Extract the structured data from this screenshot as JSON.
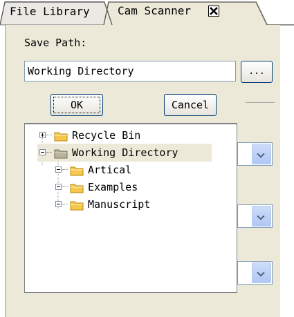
{
  "tabs": [
    {
      "label": "File Library"
    },
    {
      "label": "Cam Scanner",
      "active": true
    }
  ],
  "panel": {
    "save_path_label": "Save Path:",
    "path_value": "Working Directory",
    "browse_label": "..."
  },
  "popup": {
    "ok_label": "OK",
    "cancel_label": "Cancel",
    "tree": [
      {
        "label": "Recycle Bin",
        "level": 0,
        "expander": "plus",
        "selected": false
      },
      {
        "label": "Working Directory",
        "level": 0,
        "expander": "minus",
        "selected": true
      },
      {
        "label": "Artical",
        "level": 1,
        "expander": "minus",
        "selected": false
      },
      {
        "label": "Examples",
        "level": 1,
        "expander": "minus",
        "selected": false
      },
      {
        "label": "Manuscript",
        "level": 1,
        "expander": "minus",
        "selected": false
      }
    ]
  },
  "icons": {
    "tab_close": "close-icon",
    "folder": "folder-icon",
    "combo_arrow": "chevron-down-icon"
  },
  "colors": {
    "panel_bg": "#ece9d8",
    "folder_yellow": "#f5c84c",
    "folder_selected": "#b9b49a",
    "combo_arrow": "#b0c8f4"
  }
}
